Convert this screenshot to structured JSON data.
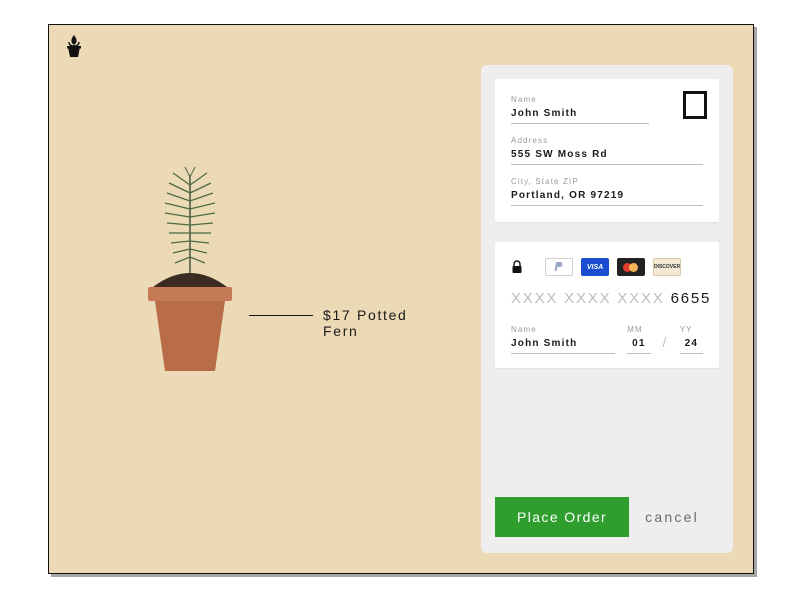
{
  "product": {
    "label": "$17 Potted Fern"
  },
  "shipping": {
    "name_label": "Name",
    "name": "John Smith",
    "address_label": "Address",
    "address": "555 SW Moss Rd",
    "city_label": "City, State ZIP",
    "city": "Portland, OR 97219"
  },
  "payment": {
    "methods": {
      "visa": "VISA",
      "discover": "DISCOVER"
    },
    "card_mask": "XXXX XXXX XXXX",
    "card_last4": "6655",
    "name_label": "Name",
    "name": "John Smith",
    "mm_label": "MM",
    "mm": "01",
    "yy_label": "YY",
    "yy": "24"
  },
  "actions": {
    "place_order": "Place Order",
    "cancel": "cancel"
  }
}
